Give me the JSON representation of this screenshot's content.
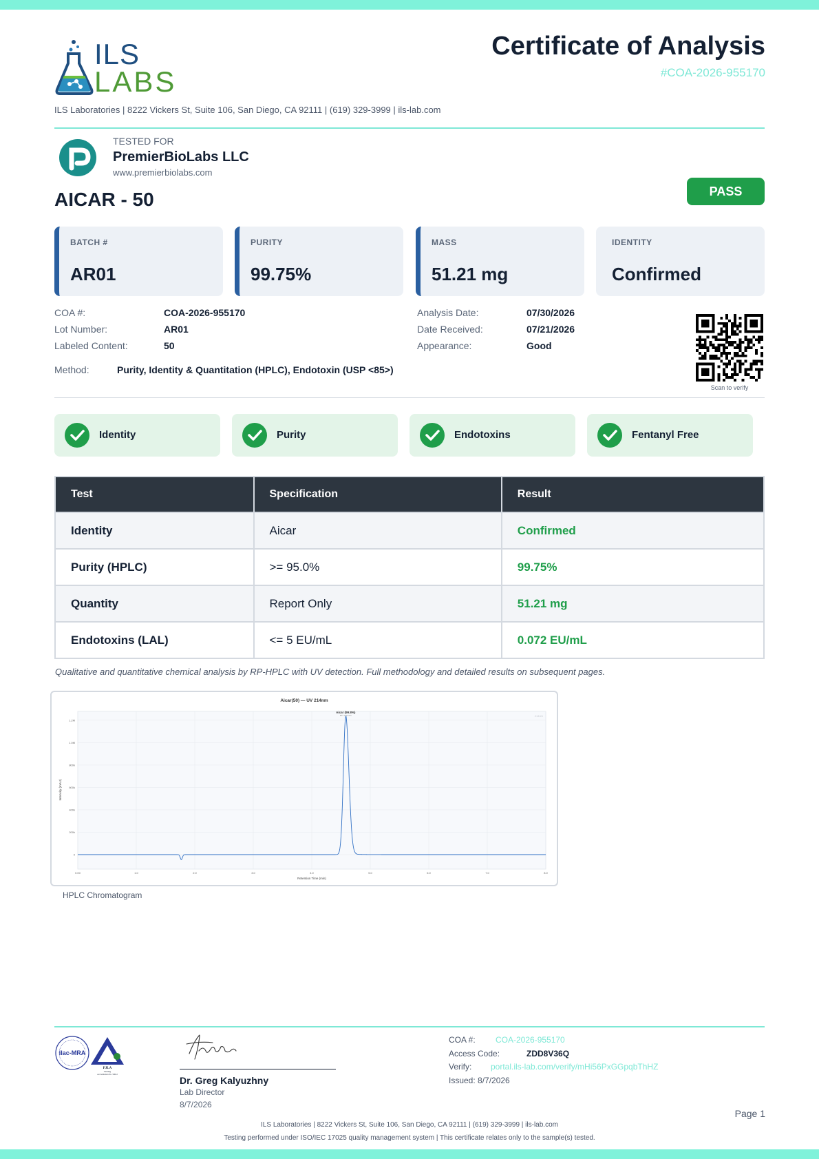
{
  "header": {
    "logo_top": "ILS",
    "logo_bottom": "LABS",
    "title": "Certificate of Analysis",
    "coa_id": "#COA-2026-955170",
    "lab_line": "ILS Laboratories  |  8222 Vickers St, Suite 106, San Diego, CA 92111  |  (619) 329-3999  |  ils-lab.com"
  },
  "client": {
    "tested_for_label": "TESTED FOR",
    "name": "PremierBioLabs LLC",
    "url": "www.premierbiolabs.com"
  },
  "product": "AICAR - 50",
  "status": "PASS",
  "stats": [
    {
      "label": "BATCH #",
      "value": "AR01"
    },
    {
      "label": "PURITY",
      "value": "99.75%"
    },
    {
      "label": "MASS",
      "value": "51.21 mg"
    },
    {
      "label": "IDENTITY",
      "value": "Confirmed"
    }
  ],
  "info_left": [
    {
      "key": "COA #:",
      "value": "COA-2026-955170"
    },
    {
      "key": "Lot Number:",
      "value": "AR01"
    },
    {
      "key": "Labeled Content:",
      "value": "50"
    }
  ],
  "info_right": [
    {
      "key": "Analysis Date:",
      "value": "07/30/2026"
    },
    {
      "key": "Date Received:",
      "value": "07/21/2026"
    },
    {
      "key": "Appearance:",
      "value": "Good"
    }
  ],
  "method": {
    "key": "Method:",
    "value": "Purity, Identity & Quantitation (HPLC), Endotoxin (USP <85>)"
  },
  "qr_caption": "Scan to verify",
  "badges": [
    "Identity",
    "Purity",
    "Endotoxins",
    "Fentanyl Free"
  ],
  "table": {
    "headers": [
      "Test",
      "Specification",
      "Result"
    ],
    "rows": [
      {
        "test": "Identity",
        "spec": "Aicar",
        "result": "Confirmed"
      },
      {
        "test": "Purity (HPLC)",
        "spec": ">= 95.0%",
        "result": "99.75%"
      },
      {
        "test": "Quantity",
        "spec": "Report Only",
        "result": "51.21 mg"
      },
      {
        "test": "Endotoxins (LAL)",
        "spec": "<= 5 EU/mL",
        "result": "0.072 EU/mL"
      }
    ]
  },
  "note": "Qualitative and quantitative chemical analysis by RP-HPLC with UV detection. Full methodology and detailed results on subsequent pages.",
  "chart_data": {
    "type": "line",
    "title": "Aicar(50) — UV 214nm",
    "xlabel": "Retention Time (min)",
    "ylabel": "Intensity (mAU)",
    "xlim": [
      0,
      8
    ],
    "ylim": [
      -50000,
      1250000
    ],
    "xticks": [
      "0.00",
      "1.0",
      "2.0",
      "3.0",
      "4.0",
      "5.0",
      "6.0",
      "7.0",
      "8.0"
    ],
    "yticks": [
      "0",
      "200k",
      "400k",
      "600k",
      "800k",
      "1.0M",
      "1.2M"
    ],
    "peak_label": "Aicar (99.8%)",
    "peak_sublabel": "RT: 4.58 min",
    "corner_label": "214nm",
    "peak": {
      "rt": 4.58,
      "height": 1230000,
      "width": 0.04
    },
    "dip": {
      "rt": 1.77,
      "depth": -45000
    },
    "grid": true
  },
  "chart_caption": "HPLC Chromatogram",
  "signature": {
    "name": "Dr. Greg Kalyuzhny",
    "title": "Lab Director",
    "date": "8/7/2026"
  },
  "seal": {
    "left_text": "ilac-MRA",
    "right_text": "PJLA",
    "right_sub": "Testing",
    "accreditation": "Accreditation No. 59612"
  },
  "footer_info": {
    "coa_label": "COA #:",
    "coa_value": "COA-2026-955170",
    "access_label": "Access Code:",
    "access_value": "ZDD8V36Q",
    "verify_label": "Verify:",
    "verify_value": "portal.ils-lab.com/verify/mHi56PxGGpqbThHZ",
    "issued": "Issued: 8/7/2026"
  },
  "page": "Page 1",
  "footer_line1": "ILS Laboratories  |  8222 Vickers St, Suite 106, San Diego, CA 92111  |  (619) 329-3999  |  ils-lab.com",
  "footer_line2": "Testing performed under ISO/IEC 17025 quality management system  |  This certificate relates only to the sample(s) tested.",
  "colors": {
    "accent": "#7ee8d6",
    "pass": "#1f9e4a",
    "card_bar": "#2a5fa0",
    "table_head": "#2d3640"
  }
}
